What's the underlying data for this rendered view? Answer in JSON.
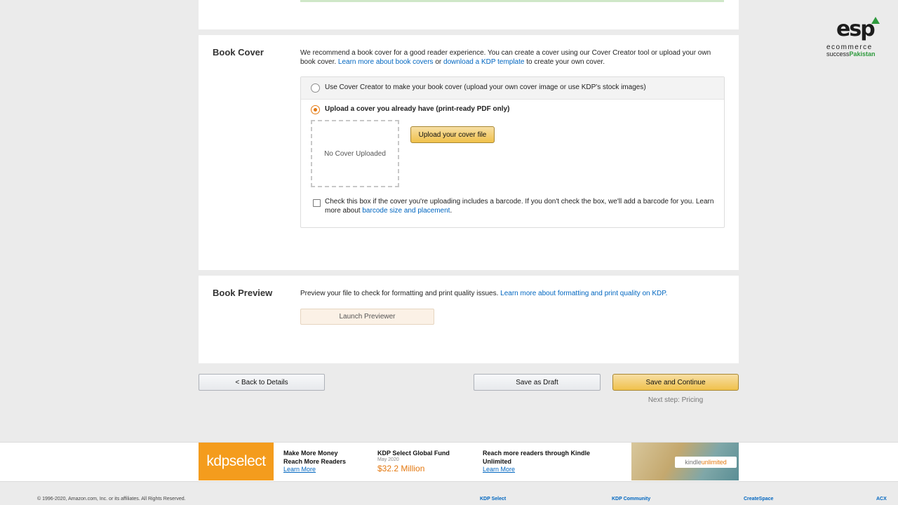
{
  "book_cover": {
    "title": "Book Cover",
    "desc_pre": "We recommend a book cover for a good reader experience. You can create a cover using our Cover Creator tool or upload your own book cover. ",
    "link_covers": "Learn more about book covers",
    "desc_mid": " or ",
    "link_template": "download a KDP template",
    "desc_post": " to create your own cover.",
    "option_creator": "Use Cover Creator to make your book cover (upload your own cover image or use KDP's stock images)",
    "option_upload": "Upload a cover you already have (print-ready PDF only)",
    "selected_option": "upload",
    "no_cover_text": "No Cover Uploaded",
    "upload_button": "Upload your cover file",
    "barcode_text": "Check this box if the cover you're uploading includes a barcode. If you don't check the box, we'll add a barcode for you. Learn more about ",
    "barcode_link": "barcode size and placement",
    "barcode_end": ".",
    "barcode_checked": false
  },
  "book_preview": {
    "title": "Book Preview",
    "desc": "Preview your file to check for formatting and print quality issues. ",
    "link": "Learn more about formatting and print quality on KDP.",
    "launch_button": "Launch Previewer"
  },
  "nav": {
    "back": "< Back to Details",
    "save_draft": "Save as Draft",
    "save_continue": "Save and Continue",
    "next_step": "Next step: Pricing"
  },
  "banner": {
    "logo_kdp": "kdp",
    "logo_select": "select",
    "promo1_line1": "Make More Money",
    "promo1_line2": "Reach More Readers",
    "promo1_link": "Learn More",
    "promo2_title": "KDP Select Global Fund",
    "promo2_date": "May 2020",
    "promo2_amount": "$32.2 Million",
    "promo3_line1": "Reach more readers through Kindle",
    "promo3_line2": "Unlimited",
    "promo3_link": "Learn More",
    "ku_kindle": "kindle",
    "ku_unlimited": "unlimited"
  },
  "footer": {
    "copyright": "© 1996-2020, Amazon.com, Inc. or its affiliates. All Rights Reserved.",
    "links": [
      "KDP Select",
      "KDP Community",
      "CreateSpace",
      "ACX"
    ]
  },
  "watermark": {
    "mark": "esp",
    "line1": "ecommerce",
    "line2a": "success",
    "line2b": "Pakistan"
  },
  "colors": {
    "accent_orange": "#e47911",
    "button_yellow": "#f0c14b",
    "link_blue": "#0066c0",
    "kdp_select_orange": "#f49c1d"
  }
}
